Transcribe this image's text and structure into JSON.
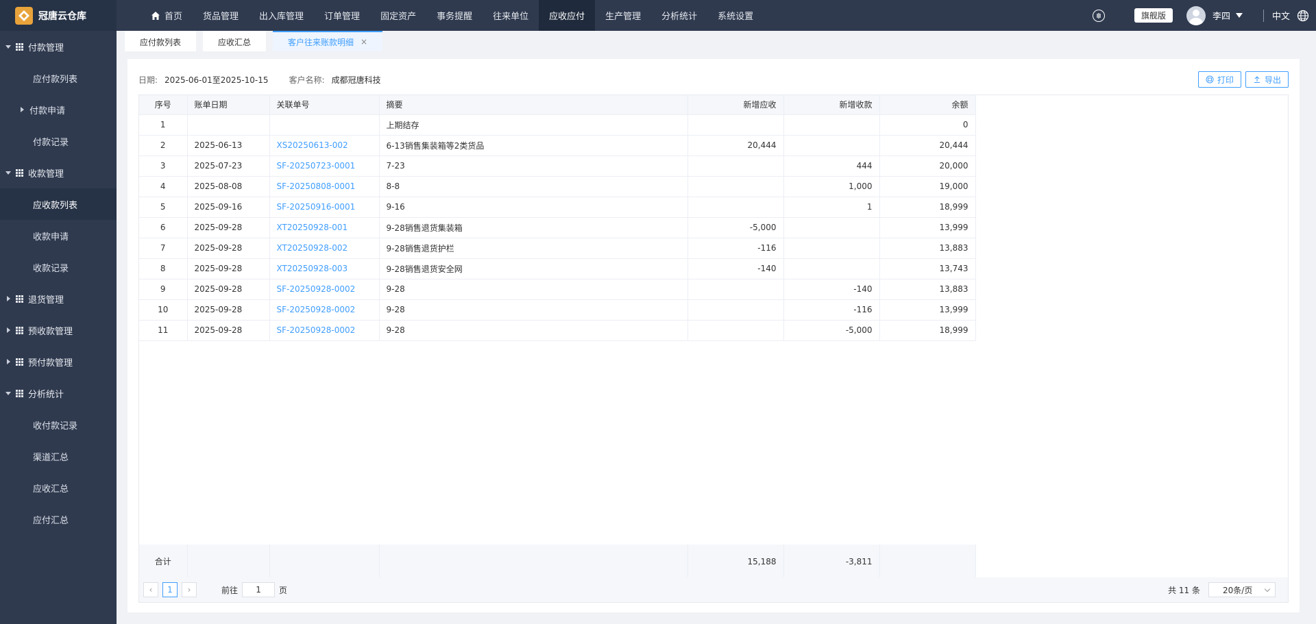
{
  "app": {
    "name": "冠唐云仓库"
  },
  "nav": {
    "items": [
      "首页",
      "货品管理",
      "出入库管理",
      "订单管理",
      "固定资产",
      "事务提醒",
      "往来单位",
      "应收应付",
      "生产管理",
      "分析统计",
      "系统设置"
    ],
    "active_index": 7
  },
  "topright": {
    "edition": "旗舰版",
    "user": "李四",
    "lang": "中文"
  },
  "sidebar": {
    "g1": "付款管理",
    "i1": "应付款列表",
    "s1": "付款申请",
    "i2": "付款记录",
    "g2": "收款管理",
    "i3": "应收款列表",
    "i4": "收款申请",
    "i5": "收款记录",
    "g3": "退货管理",
    "g4": "预收款管理",
    "g5": "预付款管理",
    "g6": "分析统计",
    "i6": "收付款记录",
    "i7": "渠道汇总",
    "i8": "应收汇总",
    "i9": "应付汇总"
  },
  "tabs": {
    "t1": "应付款列表",
    "t2": "应收汇总",
    "t3": "客户往来账款明细"
  },
  "filter": {
    "date_label": "日期:",
    "date_value": "2025-06-01至2025-10-15",
    "customer_label": "客户名称:",
    "customer_value": "成都冠唐科技"
  },
  "buttons": {
    "print": "打印",
    "export": "导出"
  },
  "table": {
    "headers": {
      "no": "序号",
      "date": "账单日期",
      "ref": "关联单号",
      "summary": "摘要",
      "recv": "新增应收",
      "got": "新增收款",
      "bal": "余额"
    },
    "rows": [
      {
        "no": "1",
        "date": "",
        "ref": "",
        "summary": "上期结存",
        "recv": "",
        "got": "",
        "bal": "0"
      },
      {
        "no": "2",
        "date": "2025-06-13",
        "ref": "XS20250613-002",
        "summary": "6-13销售集装箱等2类货品",
        "recv": "20,444",
        "got": "",
        "bal": "20,444"
      },
      {
        "no": "3",
        "date": "2025-07-23",
        "ref": "SF-20250723-0001",
        "summary": "7-23",
        "recv": "",
        "got": "444",
        "bal": "20,000"
      },
      {
        "no": "4",
        "date": "2025-08-08",
        "ref": "SF-20250808-0001",
        "summary": "8-8",
        "recv": "",
        "got": "1,000",
        "bal": "19,000"
      },
      {
        "no": "5",
        "date": "2025-09-16",
        "ref": "SF-20250916-0001",
        "summary": "9-16",
        "recv": "",
        "got": "1",
        "bal": "18,999"
      },
      {
        "no": "6",
        "date": "2025-09-28",
        "ref": "XT20250928-001",
        "summary": "9-28销售退货集装箱",
        "recv": "-5,000",
        "got": "",
        "bal": "13,999"
      },
      {
        "no": "7",
        "date": "2025-09-28",
        "ref": "XT20250928-002",
        "summary": "9-28销售退货护栏",
        "recv": "-116",
        "got": "",
        "bal": "13,883"
      },
      {
        "no": "8",
        "date": "2025-09-28",
        "ref": "XT20250928-003",
        "summary": "9-28销售退货安全网",
        "recv": "-140",
        "got": "",
        "bal": "13,743"
      },
      {
        "no": "9",
        "date": "2025-09-28",
        "ref": "SF-20250928-0002",
        "summary": "9-28",
        "recv": "",
        "got": "-140",
        "bal": "13,883"
      },
      {
        "no": "10",
        "date": "2025-09-28",
        "ref": "SF-20250928-0002",
        "summary": "9-28",
        "recv": "",
        "got": "-116",
        "bal": "13,999"
      },
      {
        "no": "11",
        "date": "2025-09-28",
        "ref": "SF-20250928-0002",
        "summary": "9-28",
        "recv": "",
        "got": "-5,000",
        "bal": "18,999"
      }
    ],
    "total": {
      "label": "合计",
      "recv": "15,188",
      "got": "-3,811"
    }
  },
  "pager": {
    "current": "1",
    "goto_prefix": "前往",
    "goto_value": "1",
    "goto_suffix": "页",
    "total": "共 11 条",
    "page_size": "20条/页"
  },
  "colors": {
    "nav_bg": "#2f3a4f",
    "accent": "#409eff",
    "logo": "#e8a33b"
  },
  "icons": {
    "home": "home-icon",
    "help": "help-icon",
    "globe": "globe-icon",
    "print": "printer-icon",
    "export": "upload-icon"
  }
}
